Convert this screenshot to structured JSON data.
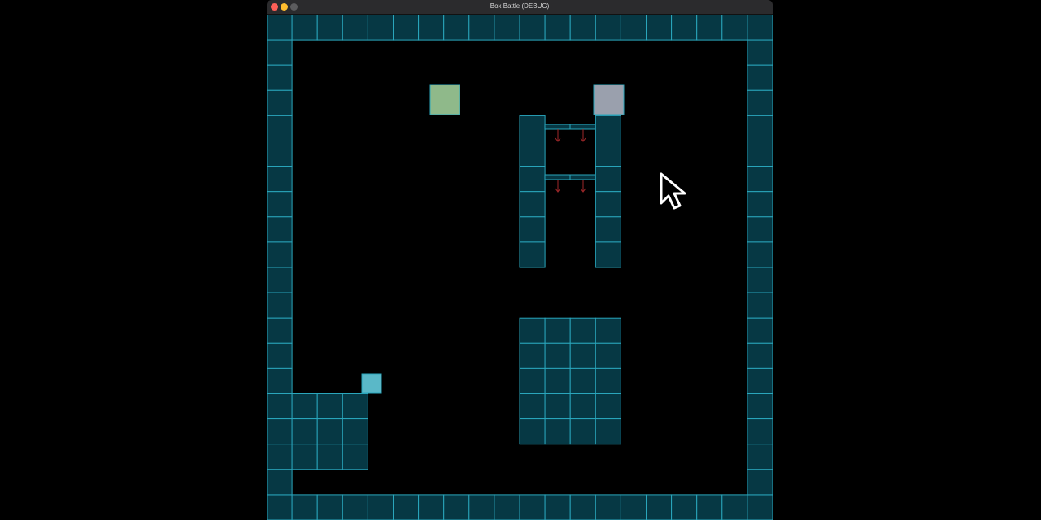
{
  "window": {
    "title": "Box Battle (DEBUG)"
  },
  "colors": {
    "wall_fill": "#063844",
    "wall_stroke": "#2aa6bc",
    "background": "#000000",
    "player_green": "#8fb98a",
    "player_gray": "#9aa0ad",
    "player_cyan": "#5ab8c8",
    "spike_red": "#a0282a"
  },
  "icons": {
    "cursor": "mouse-pointer-icon",
    "close": "close-dot-icon",
    "minimize": "minimize-dot-icon",
    "maximize": "maximize-dot-icon"
  }
}
